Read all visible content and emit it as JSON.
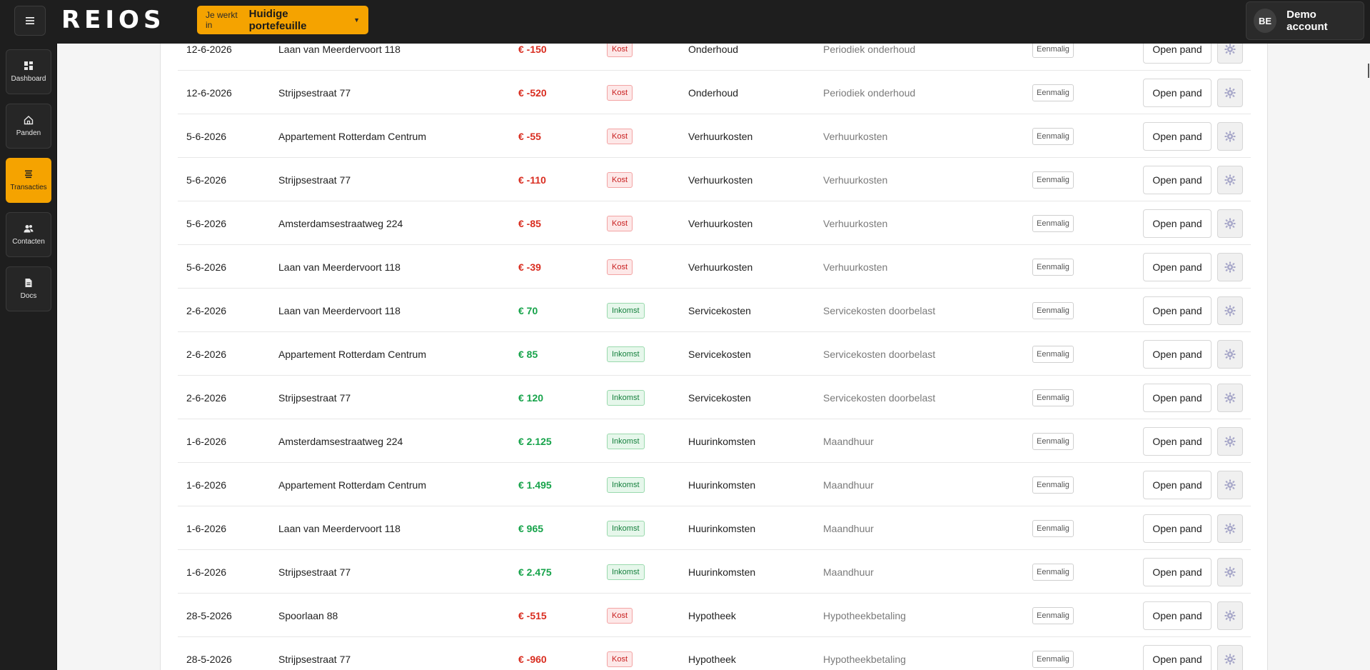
{
  "header": {
    "logo_text": "REIOS",
    "portfolio_prefix": "Je werkt in",
    "portfolio_value": "Huidige portefeuille",
    "account_initials": "BE",
    "account_name": "Demo account"
  },
  "sidebar": {
    "items": [
      {
        "label": "Dashboard",
        "icon": "dashboard-icon",
        "active": false
      },
      {
        "label": "Panden",
        "icon": "home-icon",
        "active": false
      },
      {
        "label": "Transacties",
        "icon": "list-icon",
        "active": true
      },
      {
        "label": "Contacten",
        "icon": "people-icon",
        "active": false
      },
      {
        "label": "Docs",
        "icon": "document-icon",
        "active": false
      }
    ]
  },
  "colors": {
    "accent": "#f5a300",
    "negative": "#d92d20",
    "positive": "#16a34a"
  },
  "transactions": {
    "open_label": "Open pand",
    "rows": [
      {
        "date": "12-6-2026",
        "property": "Laan van Meerdervoort 118",
        "amount": "€ -150",
        "sign": "neg",
        "type": "Kost",
        "category": "Onderhoud",
        "subcategory": "Periodiek onderhoud",
        "frequency": "Eenmalig"
      },
      {
        "date": "12-6-2026",
        "property": "Strijpsestraat 77",
        "amount": "€ -520",
        "sign": "neg",
        "type": "Kost",
        "category": "Onderhoud",
        "subcategory": "Periodiek onderhoud",
        "frequency": "Eenmalig"
      },
      {
        "date": "5-6-2026",
        "property": "Appartement Rotterdam Centrum",
        "amount": "€ -55",
        "sign": "neg",
        "type": "Kost",
        "category": "Verhuurkosten",
        "subcategory": "Verhuurkosten",
        "frequency": "Eenmalig"
      },
      {
        "date": "5-6-2026",
        "property": "Strijpsestraat 77",
        "amount": "€ -110",
        "sign": "neg",
        "type": "Kost",
        "category": "Verhuurkosten",
        "subcategory": "Verhuurkosten",
        "frequency": "Eenmalig"
      },
      {
        "date": "5-6-2026",
        "property": "Amsterdamsestraatweg 224",
        "amount": "€ -85",
        "sign": "neg",
        "type": "Kost",
        "category": "Verhuurkosten",
        "subcategory": "Verhuurkosten",
        "frequency": "Eenmalig"
      },
      {
        "date": "5-6-2026",
        "property": "Laan van Meerdervoort 118",
        "amount": "€ -39",
        "sign": "neg",
        "type": "Kost",
        "category": "Verhuurkosten",
        "subcategory": "Verhuurkosten",
        "frequency": "Eenmalig"
      },
      {
        "date": "2-6-2026",
        "property": "Laan van Meerdervoort 118",
        "amount": "€ 70",
        "sign": "pos",
        "type": "Inkomst",
        "category": "Servicekosten",
        "subcategory": "Servicekosten doorbelast",
        "frequency": "Eenmalig"
      },
      {
        "date": "2-6-2026",
        "property": "Appartement Rotterdam Centrum",
        "amount": "€ 85",
        "sign": "pos",
        "type": "Inkomst",
        "category": "Servicekosten",
        "subcategory": "Servicekosten doorbelast",
        "frequency": "Eenmalig"
      },
      {
        "date": "2-6-2026",
        "property": "Strijpsestraat 77",
        "amount": "€ 120",
        "sign": "pos",
        "type": "Inkomst",
        "category": "Servicekosten",
        "subcategory": "Servicekosten doorbelast",
        "frequency": "Eenmalig"
      },
      {
        "date": "1-6-2026",
        "property": "Amsterdamsestraatweg 224",
        "amount": "€ 2.125",
        "sign": "pos",
        "type": "Inkomst",
        "category": "Huurinkomsten",
        "subcategory": "Maandhuur",
        "frequency": "Eenmalig"
      },
      {
        "date": "1-6-2026",
        "property": "Appartement Rotterdam Centrum",
        "amount": "€ 1.495",
        "sign": "pos",
        "type": "Inkomst",
        "category": "Huurinkomsten",
        "subcategory": "Maandhuur",
        "frequency": "Eenmalig"
      },
      {
        "date": "1-6-2026",
        "property": "Laan van Meerdervoort 118",
        "amount": "€ 965",
        "sign": "pos",
        "type": "Inkomst",
        "category": "Huurinkomsten",
        "subcategory": "Maandhuur",
        "frequency": "Eenmalig"
      },
      {
        "date": "1-6-2026",
        "property": "Strijpsestraat 77",
        "amount": "€ 2.475",
        "sign": "pos",
        "type": "Inkomst",
        "category": "Huurinkomsten",
        "subcategory": "Maandhuur",
        "frequency": "Eenmalig"
      },
      {
        "date": "28-5-2026",
        "property": "Spoorlaan 88",
        "amount": "€ -515",
        "sign": "neg",
        "type": "Kost",
        "category": "Hypotheek",
        "subcategory": "Hypotheekbetaling",
        "frequency": "Eenmalig"
      },
      {
        "date": "28-5-2026",
        "property": "Strijpsestraat 77",
        "amount": "€ -960",
        "sign": "neg",
        "type": "Kost",
        "category": "Hypotheek",
        "subcategory": "Hypotheekbetaling",
        "frequency": "Eenmalig"
      }
    ]
  }
}
